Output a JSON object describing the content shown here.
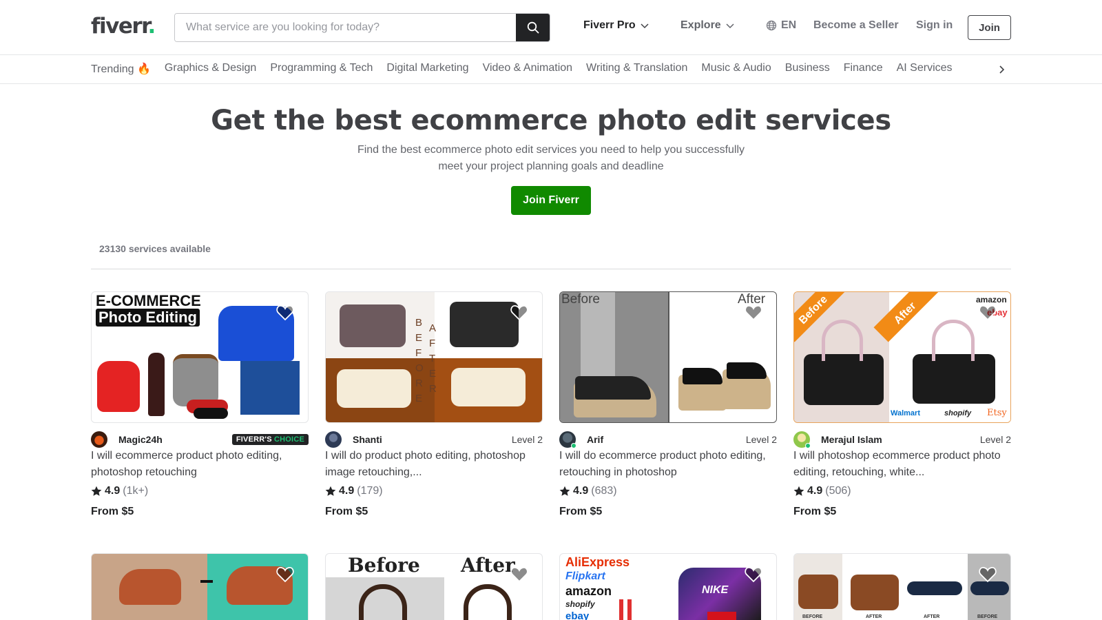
{
  "header": {
    "logo": "fiverr",
    "logo_dot": ".",
    "search_placeholder": "What service are you looking for today?",
    "nav": {
      "pro": "Fiverr Pro",
      "explore": "Explore",
      "lang": "EN",
      "become_seller": "Become a Seller",
      "sign_in": "Sign in",
      "join": "Join"
    }
  },
  "categories": [
    "Trending 🔥",
    "Graphics & Design",
    "Programming & Tech",
    "Digital Marketing",
    "Video & Animation",
    "Writing & Translation",
    "Music & Audio",
    "Business",
    "Finance",
    "AI Services"
  ],
  "hero": {
    "title": "Get the best ecommerce photo edit services",
    "subtitle_line1": "Find the best ecommerce photo edit services you need to help you successfully",
    "subtitle_line2": "meet your project planning goals and deadline",
    "cta": "Join Fiverr"
  },
  "results": {
    "count": "23130 services available"
  },
  "gigs": [
    {
      "seller": "Magic24h",
      "badge_part1": "FIVERR'S ",
      "badge_part2": "CHOICE",
      "level": "",
      "title": "I will ecommerce product photo editing, photoshop retouching",
      "rating": "4.9",
      "reviews": "(1k+)",
      "price": "From $5",
      "image_text_1": "E-COMMERCE",
      "image_text_2": "Photo Editing"
    },
    {
      "seller": "Shanti",
      "level": "Level 2",
      "title": "I will do product photo editing, photoshop image retouching,...",
      "rating": "4.9",
      "reviews": "(179)",
      "price": "From $5",
      "image_text_1": "BEFORE",
      "image_text_2": "AFTER"
    },
    {
      "seller": "Arif",
      "level": "Level 2",
      "title": "I will do ecommerce product photo editing, retouching in photoshop",
      "rating": "4.9",
      "reviews": "(683)",
      "price": "From $5",
      "image_text_1": "Before",
      "image_text_2": "After"
    },
    {
      "seller": "Merajul Islam",
      "level": "Level 2",
      "title": "I will photoshop ecommerce product photo editing, retouching, white...",
      "rating": "4.9",
      "reviews": "(506)",
      "price": "From $5",
      "image_text_1": "Before",
      "image_text_2": "After",
      "image_brands": [
        "amazon",
        "ebay",
        "Walmart",
        "shopify",
        "Etsy"
      ]
    }
  ],
  "gigs_row2": [
    {
      "image_text_1": "",
      "image_text_2": ""
    },
    {
      "image_text_1": "Before",
      "image_text_2": "After"
    },
    {
      "image_brands": [
        "AliExpress",
        "Flipkart",
        "amazon",
        "shopify",
        "ebay"
      ],
      "image_text_1": "NIKE"
    },
    {
      "image_labels": [
        "BEFORE",
        "AFTER",
        "AFTER",
        "BEFORE"
      ]
    }
  ],
  "colors": {
    "brand_green": "#1dbf73",
    "cta_green": "#108a00",
    "text_dark": "#404145",
    "text_muted": "#62646a"
  },
  "icons": {
    "search": "search-icon",
    "chevron": "chevron-down-icon",
    "globe": "globe-icon",
    "heart": "heart-icon",
    "star": "star-icon",
    "next": "chevron-right-icon"
  }
}
